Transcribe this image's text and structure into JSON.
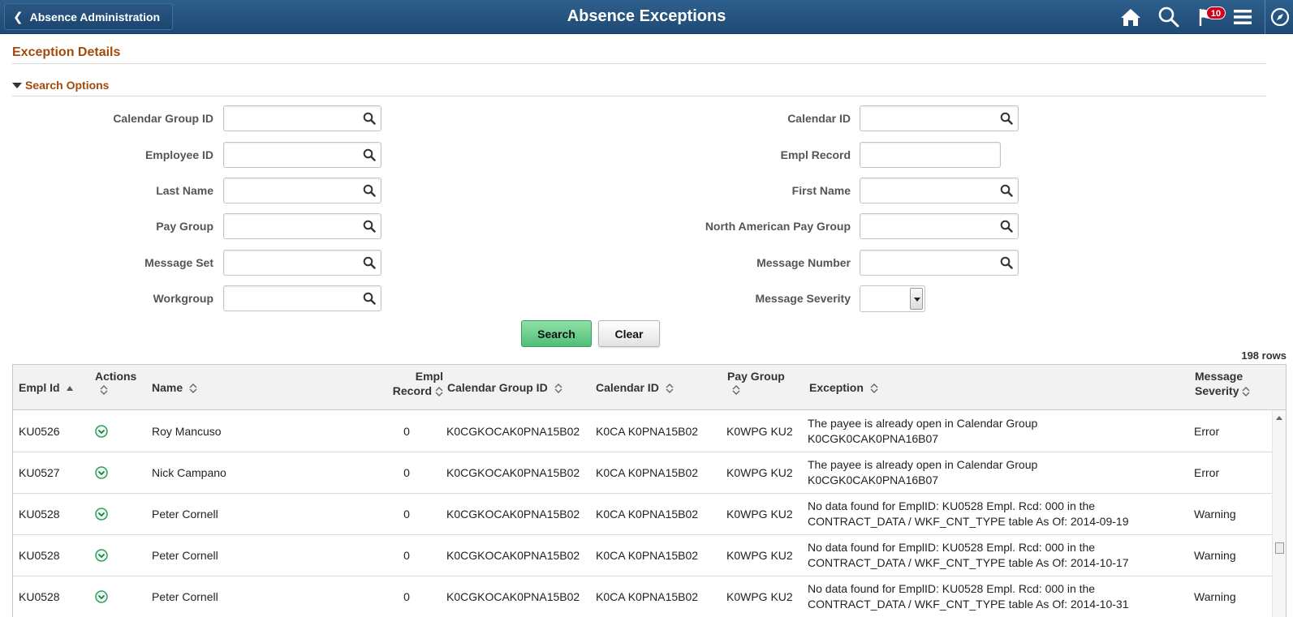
{
  "header": {
    "back_label": "Absence Administration",
    "title": "Absence Exceptions",
    "notification_count": "10",
    "icons": [
      "home-icon",
      "search-icon",
      "flag-icon",
      "menu-icon",
      "compass-icon"
    ],
    "bar_color": "#245281"
  },
  "section_title": "Exception Details",
  "search_options": {
    "label": "Search Options",
    "fields_left": [
      {
        "label": "Calendar Group ID",
        "value": ""
      },
      {
        "label": "Employee ID",
        "value": ""
      },
      {
        "label": "Last Name",
        "value": ""
      },
      {
        "label": "Pay Group",
        "value": ""
      },
      {
        "label": "Message Set",
        "value": ""
      },
      {
        "label": "Workgroup",
        "value": ""
      }
    ],
    "fields_right": [
      {
        "label": "Calendar ID",
        "value": ""
      },
      {
        "label": "Empl Record",
        "value": ""
      },
      {
        "label": "First Name",
        "value": ""
      },
      {
        "label": "North American Pay Group",
        "value": ""
      },
      {
        "label": "Message Number",
        "value": ""
      },
      {
        "label": "Message Severity",
        "value": ""
      }
    ],
    "search_button": "Search",
    "clear_button": "Clear"
  },
  "grid": {
    "row_count": "198 rows",
    "columns": {
      "empl_id": "Empl Id",
      "actions": "Actions",
      "name": "Name",
      "empl_record_1": "Empl",
      "empl_record_2": "Record",
      "cal_group_id": "Calendar Group ID",
      "calendar_id": "Calendar ID",
      "pay_group": "Pay Group",
      "exception": "Exception",
      "severity_1": "Message",
      "severity_2": "Severity"
    },
    "rows": [
      {
        "empl_id": "KU0526",
        "name": "Roy Mancuso",
        "empl_record": "0",
        "cal_group_id": "K0CGKOCAK0PNA15B02",
        "calendar_id": "K0CA K0PNA15B02",
        "pay_group": "K0WPG KU2",
        "exception_1": "The payee is already open in Calendar Group",
        "exception_2": "K0CGK0CAK0PNA16B07",
        "severity": "Error"
      },
      {
        "empl_id": "KU0527",
        "name": "Nick Campano",
        "empl_record": "0",
        "cal_group_id": "K0CGKOCAK0PNA15B02",
        "calendar_id": "K0CA K0PNA15B02",
        "pay_group": "K0WPG KU2",
        "exception_1": "The payee is already open in Calendar Group",
        "exception_2": "K0CGK0CAK0PNA16B07",
        "severity": "Error"
      },
      {
        "empl_id": "KU0528",
        "name": "Peter Cornell",
        "empl_record": "0",
        "cal_group_id": "K0CGKOCAK0PNA15B02",
        "calendar_id": "K0CA K0PNA15B02",
        "pay_group": "K0WPG KU2",
        "exception_1": "No data found for EmplID: KU0528 Empl. Rcd: 000 in the",
        "exception_2": "CONTRACT_DATA / WKF_CNT_TYPE table As Of: 2014-09-19",
        "severity": "Warning"
      },
      {
        "empl_id": "KU0528",
        "name": "Peter Cornell",
        "empl_record": "0",
        "cal_group_id": "K0CGKOCAK0PNA15B02",
        "calendar_id": "K0CA K0PNA15B02",
        "pay_group": "K0WPG KU2",
        "exception_1": "No data found for EmplID: KU0528 Empl. Rcd: 000 in the",
        "exception_2": "CONTRACT_DATA / WKF_CNT_TYPE table As Of: 2014-10-17",
        "severity": "Warning"
      },
      {
        "empl_id": "KU0528",
        "name": "Peter Cornell",
        "empl_record": "0",
        "cal_group_id": "K0CGKOCAK0PNA15B02",
        "calendar_id": "K0CA K0PNA15B02",
        "pay_group": "K0WPG KU2",
        "exception_1": "No data found for EmplID: KU0528 Empl. Rcd: 000 in the",
        "exception_2": "CONTRACT_DATA / WKF_CNT_TYPE table As Of: 2014-10-31",
        "severity": "Warning"
      }
    ]
  }
}
